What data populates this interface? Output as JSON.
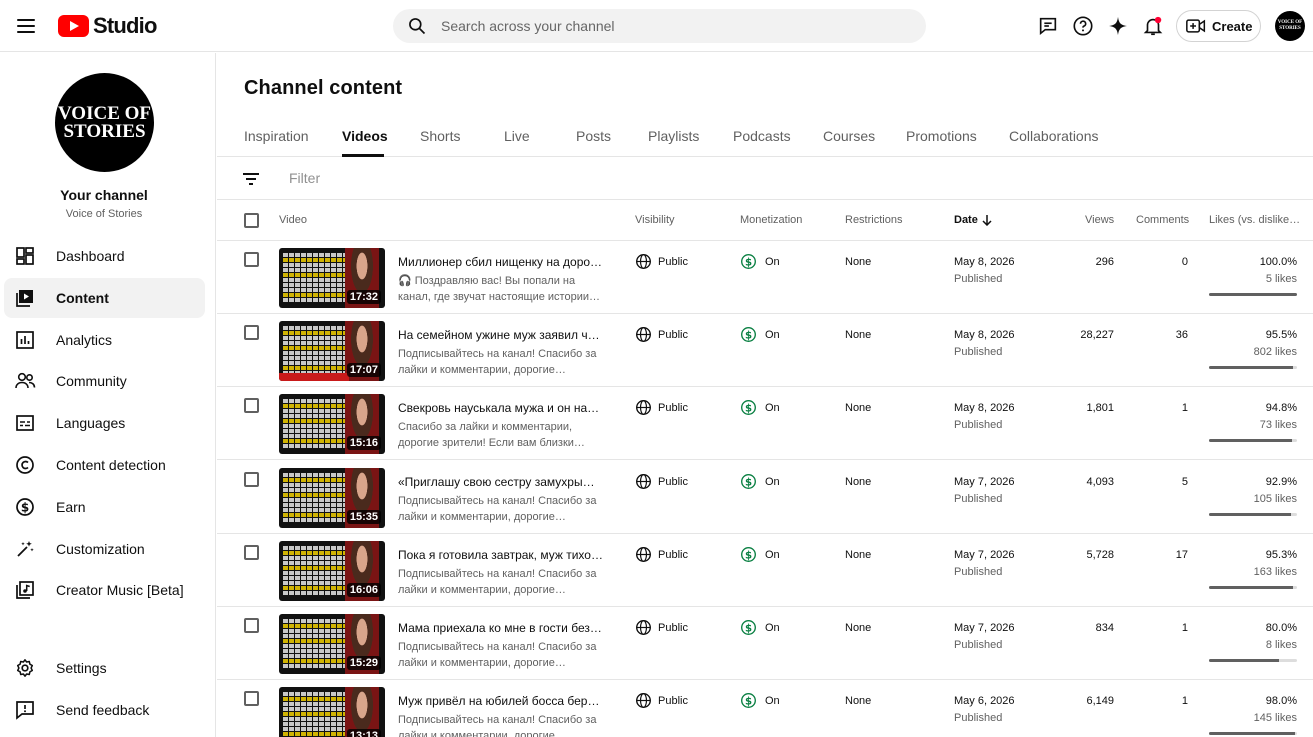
{
  "header": {
    "studio_label": "Studio",
    "search_placeholder": "Search across your channel",
    "create_label": "Create",
    "avatar_text": "VOICE OF STORIES"
  },
  "sidebar": {
    "channel_avatar_text": "VOICE OF STORIES",
    "channel_title": "Your channel",
    "channel_name": "Voice of Stories",
    "items": [
      {
        "label": "Dashboard",
        "icon": "dashboard-icon"
      },
      {
        "label": "Content",
        "icon": "content-icon",
        "active": true
      },
      {
        "label": "Analytics",
        "icon": "analytics-icon"
      },
      {
        "label": "Community",
        "icon": "community-icon"
      },
      {
        "label": "Languages",
        "icon": "languages-icon"
      },
      {
        "label": "Content detection",
        "icon": "content-detection-icon"
      },
      {
        "label": "Earn",
        "icon": "earn-icon"
      },
      {
        "label": "Customization",
        "icon": "customization-icon"
      },
      {
        "label": "Creator Music [Beta]",
        "icon": "creator-music-icon"
      },
      {
        "label": "Settings",
        "icon": "settings-icon"
      },
      {
        "label": "Send feedback",
        "icon": "feedback-icon"
      }
    ]
  },
  "main": {
    "title": "Channel content",
    "tabs": [
      "Inspiration",
      "Videos",
      "Shorts",
      "Live",
      "Posts",
      "Playlists",
      "Podcasts",
      "Courses",
      "Promotions",
      "Collaborations"
    ],
    "active_tab": "Videos",
    "filter_placeholder": "Filter",
    "columns": {
      "video": "Video",
      "visibility": "Visibility",
      "monetization": "Monetization",
      "restrictions": "Restrictions",
      "date": "Date",
      "views": "Views",
      "comments": "Comments",
      "likes": "Likes (vs. dislike…"
    }
  },
  "rows": [
    {
      "title": "Миллионер сбил нищенку на дороге…",
      "desc": "🎧 Поздравляю вас! Вы попали на канал, где звучат настоящие истории…",
      "duration": "17:32",
      "visibility": "Public",
      "monetization": "On",
      "restrictions": "None",
      "date": "May 8, 2026",
      "status": "Published",
      "views": "296",
      "comments": "0",
      "likes_pct": "100.0%",
      "likes_count": "5 likes",
      "likes_ratio": 1.0
    },
    {
      "title": "На семейном ужине муж заявил что…",
      "desc": "Подписывайтесь на канал! Спасибо за лайки и комментарии, дорогие зрител…",
      "duration": "17:07",
      "visibility": "Public",
      "monetization": "On",
      "restrictions": "None",
      "date": "May 8, 2026",
      "status": "Published",
      "views": "28,227",
      "comments": "36",
      "likes_pct": "95.5%",
      "likes_count": "802 likes",
      "likes_ratio": 0.955
    },
    {
      "title": "Свекровь науськала мужа и он набр…",
      "desc": "Спасибо за лайки и комментарии, дорогие зрители! Если вам близки…",
      "duration": "15:16",
      "visibility": "Public",
      "monetization": "On",
      "restrictions": "None",
      "date": "May 8, 2026",
      "status": "Published",
      "views": "1,801",
      "comments": "1",
      "likes_pct": "94.8%",
      "likes_count": "73 likes",
      "likes_ratio": 0.948
    },
    {
      "title": "«Приглашу свою сестру замухрышк…",
      "desc": "Подписывайтесь на канал! Спасибо за лайки и комментарии, дорогие зрител…",
      "duration": "15:35",
      "visibility": "Public",
      "monetization": "On",
      "restrictions": "None",
      "date": "May 7, 2026",
      "status": "Published",
      "views": "4,093",
      "comments": "5",
      "likes_pct": "92.9%",
      "likes_count": "105 likes",
      "likes_ratio": 0.929
    },
    {
      "title": "Пока я готовила завтрак, муж тихо …",
      "desc": "Подписывайтесь на канал! Спасибо за лайки и комментарии, дорогие зрител…",
      "duration": "16:06",
      "visibility": "Public",
      "monetization": "On",
      "restrictions": "None",
      "date": "May 7, 2026",
      "status": "Published",
      "views": "5,728",
      "comments": "17",
      "likes_pct": "95.3%",
      "likes_count": "163 likes",
      "likes_ratio": 0.953
    },
    {
      "title": "Мама приехала ко мне в гости без п…",
      "desc": "Подписывайтесь на канал! Спасибо за лайки и комментарии, дорогие зрител…",
      "duration": "15:29",
      "visibility": "Public",
      "monetization": "On",
      "restrictions": "None",
      "date": "May 7, 2026",
      "status": "Published",
      "views": "834",
      "comments": "1",
      "likes_pct": "80.0%",
      "likes_count": "8 likes",
      "likes_ratio": 0.8
    },
    {
      "title": "Муж привёл на юбилей босса берем…",
      "desc": "Подписывайтесь на канал! Спасибо за лайки и комментарии, дорогие зрител…",
      "duration": "13:13",
      "visibility": "Public",
      "monetization": "On",
      "restrictions": "None",
      "date": "May 6, 2026",
      "status": "Published",
      "views": "6,149",
      "comments": "1",
      "likes_pct": "98.0%",
      "likes_count": "145 likes",
      "likes_ratio": 0.98
    }
  ]
}
